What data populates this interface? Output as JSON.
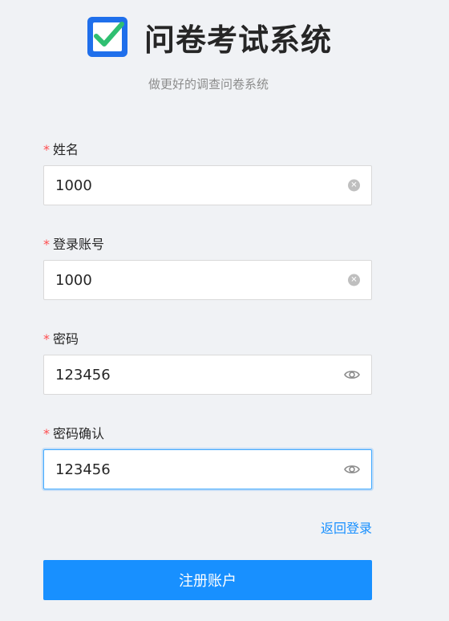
{
  "header": {
    "title": "问卷考试系统",
    "subtitle": "做更好的调查问卷系统",
    "logo_color": "#1f6feb",
    "logo_check_color": "#2fbf71"
  },
  "form": {
    "required_mark": "*",
    "fields": [
      {
        "label": "姓名",
        "value": "1000",
        "suffix_icon": "clear-icon"
      },
      {
        "label": "登录账号",
        "value": "1000",
        "suffix_icon": "clear-icon"
      },
      {
        "label": "密码",
        "value": "123456",
        "suffix_icon": "eye-icon"
      },
      {
        "label": "密码确认",
        "value": "123456",
        "suffix_icon": "eye-icon",
        "focused": true
      }
    ],
    "back_link": "返回登录",
    "submit_label": "注册账户"
  },
  "colors": {
    "background": "#f0f2f5",
    "accent": "#1890ff",
    "required": "#ff4d4f"
  }
}
